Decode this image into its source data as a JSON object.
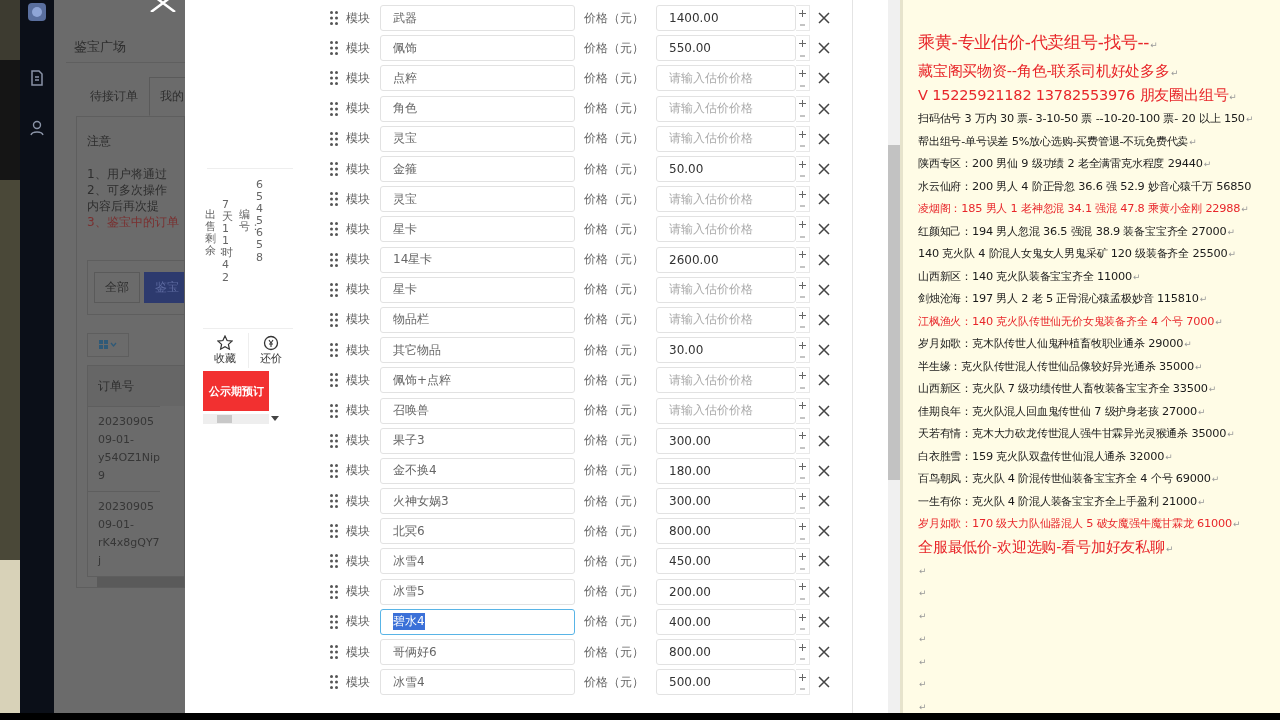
{
  "background_page": {
    "title": "鉴宝广场",
    "tabs": [
      {
        "label": "待接订单",
        "selected": false
      },
      {
        "label": "我的",
        "selected": true
      }
    ],
    "notice": {
      "heading": "注意",
      "lines": [
        {
          "text": "1、用户将通过",
          "kind": "normal"
        },
        {
          "text": "2、可多次操作",
          "kind": "normal"
        },
        {
          "text": "内容后再次提",
          "kind": "normal"
        },
        {
          "text": "3、鉴宝中的订单",
          "kind": "warning"
        }
      ]
    },
    "filters": [
      {
        "label": "全部",
        "selected": false
      },
      {
        "label": "鉴宝",
        "selected": true
      }
    ],
    "table": {
      "columns": [
        "订单号"
      ],
      "rows": [
        [
          "2023090509-01-y54OZ1Nip9"
        ],
        [
          "2023090509-01-rK4x8gQY7j"
        ]
      ]
    }
  },
  "listing": {
    "countdown_label": "出售剩余：",
    "countdown": "7天11时42",
    "number_label": "编号：",
    "number": "6545658",
    "actions": [
      {
        "label": "收藏",
        "kind": "favorite"
      },
      {
        "label": "还价",
        "kind": "offer"
      }
    ],
    "reserve_button": "公示期预订"
  },
  "modules": {
    "rows": [
      {
        "label": "模块",
        "name": "武器",
        "price_label": "价格（元）",
        "price": "1400.00",
        "focused": false
      },
      {
        "label": "模块",
        "name": "佩饰",
        "price_label": "价格（元）",
        "price": "550.00",
        "focused": false
      },
      {
        "label": "模块",
        "name": "点粹",
        "price_label": "价格（元）",
        "placeholder": "请输入估价价格",
        "focused": false
      },
      {
        "label": "模块",
        "name": "角色",
        "price_label": "价格（元）",
        "placeholder": "请输入估价价格",
        "focused": false
      },
      {
        "label": "模块",
        "name": "灵宝",
        "price_label": "价格（元）",
        "placeholder": "请输入估价价格",
        "focused": false
      },
      {
        "label": "模块",
        "name": "金箍",
        "price_label": "价格（元）",
        "price": "50.00",
        "focused": false
      },
      {
        "label": "模块",
        "name": "灵宝",
        "price_label": "价格（元）",
        "placeholder": "请输入估价价格",
        "focused": false
      },
      {
        "label": "模块",
        "name": "星卡",
        "price_label": "价格（元）",
        "placeholder": "请输入估价价格",
        "focused": false
      },
      {
        "label": "模块",
        "name": "14星卡",
        "price_label": "价格（元）",
        "price": "2600.00",
        "focused": false
      },
      {
        "label": "模块",
        "name": "星卡",
        "price_label": "价格（元）",
        "placeholder": "请输入估价价格",
        "focused": false
      },
      {
        "label": "模块",
        "name": "物品栏",
        "price_label": "价格（元）",
        "placeholder": "请输入估价价格",
        "focused": false
      },
      {
        "label": "模块",
        "name": "其它物品",
        "price_label": "价格（元）",
        "price": "30.00",
        "focused": false
      },
      {
        "label": "模块",
        "name": "佩饰+点粹",
        "price_label": "价格（元）",
        "placeholder": "请输入估价价格",
        "focused": false
      },
      {
        "label": "模块",
        "name": "召唤兽",
        "price_label": "价格（元）",
        "placeholder": "请输入估价价格",
        "focused": false
      },
      {
        "label": "模块",
        "name": "果子3",
        "price_label": "价格（元）",
        "price": "300.00",
        "focused": false
      },
      {
        "label": "模块",
        "name": "金不换4",
        "price_label": "价格（元）",
        "price": "180.00",
        "focused": false
      },
      {
        "label": "模块",
        "name": "火神女娲3",
        "price_label": "价格（元）",
        "price": "300.00",
        "focused": false
      },
      {
        "label": "模块",
        "name": "北冥6",
        "price_label": "价格（元）",
        "price": "800.00",
        "focused": false
      },
      {
        "label": "模块",
        "name": "冰雪4",
        "price_label": "价格（元）",
        "price": "450.00",
        "focused": false
      },
      {
        "label": "模块",
        "name": "冰雪5",
        "price_label": "价格（元）",
        "price": "200.00",
        "focused": false
      },
      {
        "label": "模块",
        "name": "碧水4",
        "price_label": "价格（元）",
        "price": "400.00",
        "focused": true
      },
      {
        "label": "模块",
        "name": "哥俩好6",
        "price_label": "价格（元）",
        "price": "800.00",
        "focused": false
      },
      {
        "label": "模块",
        "name": "冰雪4",
        "price_label": "价格（元）",
        "price": "500.00",
        "focused": false
      }
    ]
  },
  "document": {
    "lines": [
      {
        "kind": "heading",
        "text": "乘黄-专业估价-代卖组号-找号--",
        "color": "#e8262a",
        "mark": "↵"
      },
      {
        "kind": "large",
        "text": "藏宝阁买物资--角色-联系司机好处多多",
        "color": "#e8262a",
        "mark": "↵"
      },
      {
        "kind": "large",
        "text": "V 15225921182   13782553976 朋友圈出组号",
        "color": "#e8262a",
        "mark": "↵"
      },
      {
        "kind": "body",
        "text": "扫码估号 3 万内 30 票- 3-10-50 票  --10-20-100 票- 20 以上 150",
        "color": "#1a1a1a",
        "mark": "↵"
      },
      {
        "kind": "body",
        "text": "帮出组号-单号误差 5%放心选购-买费管退-不玩免费代卖",
        "color": "#1a1a1a",
        "mark": "↵"
      },
      {
        "kind": "body",
        "text": "陕西专区：200 男仙 9 级功绩 2 老全满雷克水程度 29440",
        "color": "#1a1a1a",
        "mark": "↵"
      },
      {
        "kind": "body",
        "text": "水云仙府：200 男人 4 阶正骨忽 36.6 强 52.9 妙音心猿千万 56850",
        "color": "#1a1a1a"
      },
      {
        "kind": "body",
        "text": "凌烟阁：185 男人 1 老神忽混 34.1 强混 47.8 乘黄小金刚 22988",
        "color": "#e8262a",
        "mark": "↵"
      },
      {
        "kind": "body",
        "text": "红颜知己：194 男人忽混 36.5 强混 38.9 装备宝宝齐全 27000",
        "color": "#1a1a1a",
        "mark": "↵"
      },
      {
        "kind": "body",
        "text": "140 克火队 4 阶混人女鬼女人男鬼采矿 120 级装备齐全 25500",
        "color": "#1a1a1a",
        "mark": "↵"
      },
      {
        "kind": "body",
        "text": "山西新区：140 克火队装备宝宝齐全 11000",
        "color": "#1a1a1a",
        "mark": "↵"
      },
      {
        "kind": "body",
        "text": "剑烛沧海：197 男人 2 老 5 正骨混心猿孟极妙音 115810",
        "color": "#1a1a1a",
        "mark": "↵"
      },
      {
        "kind": "body",
        "text": "江枫渔火：140 克火队传世仙无价女鬼装备齐全 4 个号 7000",
        "color": "#e8262a",
        "mark": "↵"
      },
      {
        "kind": "body",
        "text": "岁月如歌：克木队传世人仙鬼种植畜牧职业通杀 29000",
        "color": "#1a1a1a",
        "mark": "↵"
      },
      {
        "kind": "body",
        "text": "半生缘：克火队传世混人传世仙品像较好异光通杀 35000",
        "color": "#1a1a1a",
        "mark": "↵"
      },
      {
        "kind": "body",
        "text": "山西新区：克火队 7 级功绩传世人畜牧装备宝宝齐全 33500",
        "color": "#1a1a1a",
        "mark": "↵"
      },
      {
        "kind": "body",
        "text": "佳期良年：克火队混人回血鬼传世仙 7 级护身老孩 27000",
        "color": "#1a1a1a",
        "mark": "↵"
      },
      {
        "kind": "body",
        "text": "天若有情：克木大力砍龙传世混人强牛甘霖异光灵猴通杀 35000",
        "color": "#1a1a1a",
        "mark": "↵"
      },
      {
        "kind": "body",
        "text": "白衣胜雪：159 克火队双盘传世仙混人通杀 32000",
        "color": "#1a1a1a",
        "mark": "↵"
      },
      {
        "kind": "body",
        "text": "百鸟朝凤：克火队 4 阶混传世仙装备宝宝齐全 4 个号 69000",
        "color": "#1a1a1a",
        "mark": "↵"
      },
      {
        "kind": "body",
        "text": "一生有你：克火队 4 阶混人装备宝宝齐全上手盈利 21000",
        "color": "#1a1a1a",
        "mark": "↵"
      },
      {
        "kind": "body",
        "text": "岁月如歌：170 级大力队仙器混人 5 破女魔强牛魔甘霖龙 61000",
        "color": "#e8262a",
        "mark": "↵"
      },
      {
        "kind": "large",
        "text": "全服最低价-欢迎选购-看号加好友私聊",
        "color": "#e8262a",
        "mark": "↵"
      },
      {
        "kind": "blank",
        "mark": "↵"
      },
      {
        "kind": "blank",
        "mark": "↵"
      },
      {
        "kind": "blank",
        "mark": "↵"
      },
      {
        "kind": "blank",
        "mark": "↵"
      },
      {
        "kind": "blank",
        "mark": "↵"
      },
      {
        "kind": "blank",
        "mark": "↵"
      },
      {
        "kind": "blank",
        "mark": "↵"
      }
    ]
  }
}
